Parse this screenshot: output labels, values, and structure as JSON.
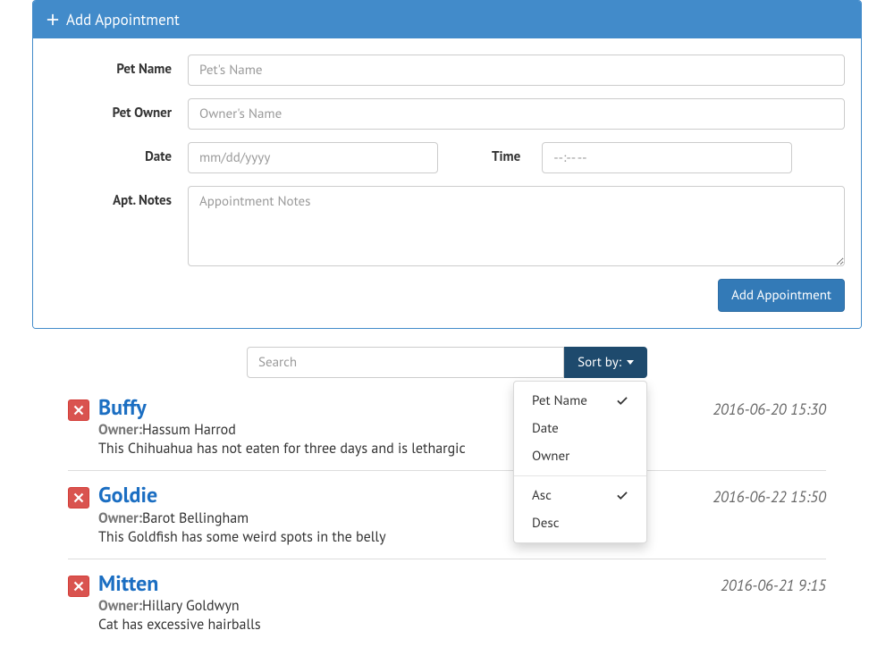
{
  "panel": {
    "title": "Add Appointment",
    "labels": {
      "petName": "Pet Name",
      "petOwner": "Pet Owner",
      "date": "Date",
      "time": "Time",
      "notes": "Apt. Notes"
    },
    "placeholders": {
      "petName": "Pet's Name",
      "petOwner": "Owner's Name",
      "date": "mm/dd/yyyy",
      "time": "--:-- --",
      "notes": "Appointment Notes"
    },
    "submit": "Add Appointment"
  },
  "search": {
    "placeholder": "Search",
    "sortLabel": "Sort by:"
  },
  "sortMenu": {
    "items": [
      "Pet Name",
      "Date",
      "Owner"
    ],
    "selectedSort": 0,
    "order": [
      "Asc",
      "Desc"
    ],
    "selectedOrder": 0
  },
  "ownerPrefix": "Owner:",
  "appointments": [
    {
      "pet": "Buffy",
      "owner": "Hassum Harrod",
      "notes": "This Chihuahua has not eaten for three days and is lethargic",
      "datetime": "2016-06-20 15:30"
    },
    {
      "pet": "Goldie",
      "owner": "Barot Bellingham",
      "notes": "This Goldfish has some weird spots in the belly",
      "datetime": "2016-06-22 15:50"
    },
    {
      "pet": "Mitten",
      "owner": "Hillary Goldwyn",
      "notes": "Cat has excessive hairballs",
      "datetime": "2016-06-21 9:15"
    }
  ]
}
